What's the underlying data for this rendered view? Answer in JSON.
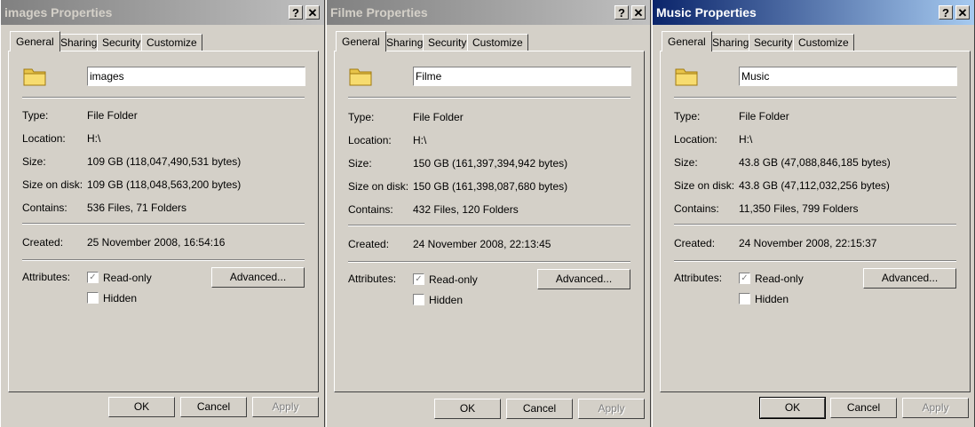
{
  "labels": {
    "tabs": [
      "General",
      "Sharing",
      "Security",
      "Customize"
    ],
    "type": "Type:",
    "location": "Location:",
    "size": "Size:",
    "size_on_disk": "Size on disk:",
    "contains": "Contains:",
    "created": "Created:",
    "attributes": "Attributes:",
    "read_only": "Read-only",
    "hidden": "Hidden",
    "advanced": "Advanced...",
    "ok": "OK",
    "cancel": "Cancel",
    "apply": "Apply"
  },
  "dialogs": [
    {
      "title": "images Properties",
      "name": "images",
      "type": "File Folder",
      "location": "H:\\",
      "size": "109 GB (118,047,490,531 bytes)",
      "size_on_disk": "109 GB (118,048,563,200 bytes)",
      "contains": "536 Files, 71 Folders",
      "created": "25 November 2008, 16:54:16",
      "active": false
    },
    {
      "title": "Filme Properties",
      "name": "Filme",
      "type": "File Folder",
      "location": "H:\\",
      "size": "150 GB (161,397,394,942 bytes)",
      "size_on_disk": "150 GB (161,398,087,680 bytes)",
      "contains": "432 Files, 120 Folders",
      "created": "24 November 2008, 22:13:45",
      "active": false
    },
    {
      "title": "Music Properties",
      "name": "Music",
      "type": "File Folder",
      "location": "H:\\",
      "size": "43.8 GB (47,088,846,185 bytes)",
      "size_on_disk": "43.8 GB (47,112,032,256 bytes)",
      "contains": "11,350 Files, 799 Folders",
      "created": "24 November 2008, 22:15:37",
      "active": true
    }
  ],
  "colors": {
    "dialog_bg": "#d4d0c8",
    "active_title": "#0a246a",
    "inactive_title": "#808080"
  }
}
